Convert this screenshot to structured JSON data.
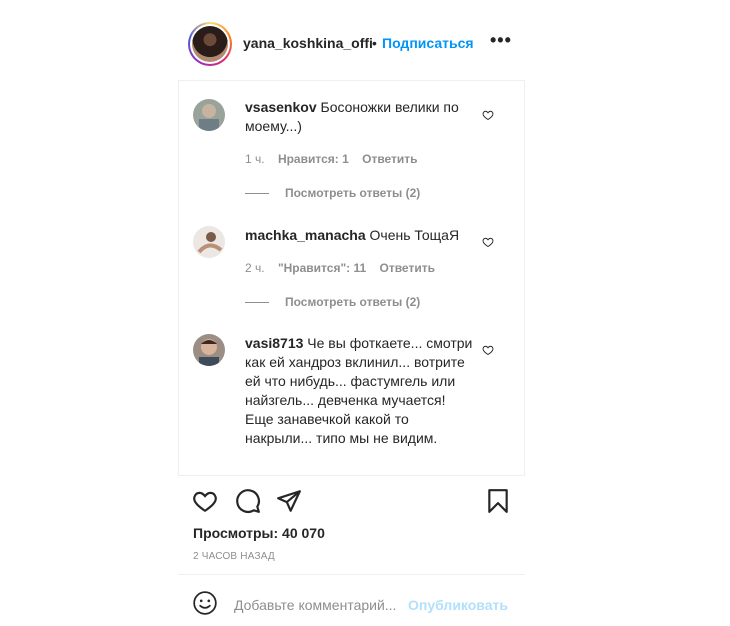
{
  "header": {
    "username": "yana_koshkina_offi",
    "separator": "•",
    "follow_label": "Подписаться",
    "more_label": "•••"
  },
  "comments": [
    {
      "username": "vsasenkov",
      "text": "Босоножки велики по моему...)",
      "time": "1 ч.",
      "likes": "Нравится: 1",
      "reply": "Ответить",
      "view_replies": "Посмотреть ответы (2)"
    },
    {
      "username": "machka_manacha",
      "text": "Очень ТощаЯ",
      "time": "2 ч.",
      "likes": "\"Нравится\": 11",
      "reply": "Ответить",
      "view_replies": "Посмотреть ответы (2)"
    },
    {
      "username": "vasi8713",
      "text": "Че вы фоткаете... смотри как ей хандроз вклинил... вотрите ей что нибудь... фастумгель или найзгель... девченка мучается! Еще занавечкой какой то накрыли... типо мы не видим.",
      "time": "",
      "likes": "",
      "reply": "",
      "view_replies": ""
    }
  ],
  "actions": {
    "icons": [
      "heart-icon",
      "comment-icon",
      "share-icon",
      "bookmark-icon"
    ]
  },
  "stats": {
    "views": "Просмотры: 40 070",
    "posted": "2 часов назад"
  },
  "comment_box": {
    "placeholder": "Добавьте комментарий...",
    "publish_label": "Опубликовать",
    "emoji_icon": "smile-icon"
  },
  "colors": {
    "link": "#0095f6",
    "publish_disabled": "#b2dffc",
    "muted": "#8e8e8e"
  }
}
